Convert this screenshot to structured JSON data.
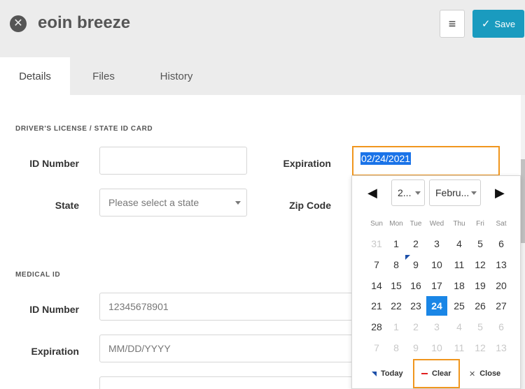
{
  "header": {
    "title": "eoin breeze",
    "save_label": "Save"
  },
  "tabs": [
    {
      "label": "Details",
      "active": true
    },
    {
      "label": "Files",
      "active": false
    },
    {
      "label": "History",
      "active": false
    }
  ],
  "drivers_license": {
    "section_title": "DRIVER'S LICENSE / STATE ID CARD",
    "id_number_label": "ID Number",
    "id_number_value": "",
    "expiration_label": "Expiration",
    "expiration_value": "02/24/2021",
    "state_label": "State",
    "state_placeholder": "Please select a state",
    "zip_label": "Zip Code"
  },
  "medical_id": {
    "section_title": "MEDICAL ID",
    "id_number_label": "ID Number",
    "id_number_value": "12345678901",
    "expiration_label": "Expiration",
    "expiration_placeholder": "MM/DD/YYYY"
  },
  "datepicker": {
    "year_display": "2...",
    "month_display": "Febru...",
    "weekdays": [
      "Sun",
      "Mon",
      "Tue",
      "Wed",
      "Thu",
      "Fri",
      "Sat"
    ],
    "weeks": [
      [
        "31",
        "1",
        "2",
        "3",
        "4",
        "5",
        "6"
      ],
      [
        "7",
        "8",
        "9",
        "10",
        "11",
        "12",
        "13"
      ],
      [
        "14",
        "15",
        "16",
        "17",
        "18",
        "19",
        "20"
      ],
      [
        "21",
        "22",
        "23",
        "24",
        "25",
        "26",
        "27"
      ],
      [
        "28",
        "1",
        "2",
        "3",
        "4",
        "5",
        "6"
      ],
      [
        "7",
        "8",
        "9",
        "10",
        "11",
        "12",
        "13"
      ]
    ],
    "selected_day": "24",
    "today_day": "9",
    "today_label": "Today",
    "clear_label": "Clear",
    "close_label": "Close"
  },
  "colors": {
    "accent": "#1a9bbf",
    "highlight": "#f0961e",
    "selected": "#1a86e6"
  }
}
